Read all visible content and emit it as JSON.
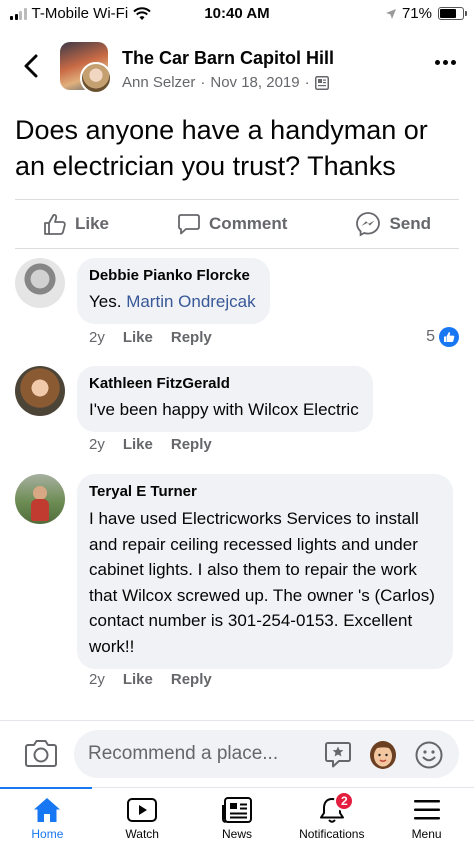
{
  "status_bar": {
    "carrier": "T-Mobile Wi-Fi",
    "time": "10:40 AM",
    "battery": "71%",
    "battery_level": 0.71
  },
  "header": {
    "group_name": "The Car Barn Capitol Hill",
    "author": "Ann Selzer",
    "separator": "·",
    "date": "Nov 18, 2019",
    "privacy_icon": "group-icon"
  },
  "post": {
    "text": "Does anyone have a handyman or an electrician you trust?  Thanks"
  },
  "post_actions": {
    "like": "Like",
    "comment": "Comment",
    "send": "Send"
  },
  "comments": [
    {
      "name": "Debbie Pianko Florcke",
      "text_prefix": "Yes. ",
      "mention": "Martin Ondrejcak",
      "age": "2y",
      "like": "Like",
      "reply": "Reply",
      "reaction_count": "5"
    },
    {
      "name": "Kathleen FitzGerald",
      "text": "I've been happy with Wilcox Electric",
      "age": "2y",
      "like": "Like",
      "reply": "Reply"
    },
    {
      "name": "Teryal E Turner",
      "text": "I have used Electricworks Services to install and repair ceiling recessed lights and under cabinet lights. I also them to repair the work that Wilcox screwed up. The owner 's (Carlos) contact number is 301-254-0153. Excellent work!!",
      "age": "2y",
      "like": "Like",
      "reply": "Reply"
    }
  ],
  "composer": {
    "placeholder": "Recommend a place..."
  },
  "tab_bar": {
    "tabs": [
      {
        "label": "Home",
        "icon": "home-icon",
        "active": true
      },
      {
        "label": "Watch",
        "icon": "watch-icon"
      },
      {
        "label": "News",
        "icon": "news-icon"
      },
      {
        "label": "Notifications",
        "icon": "bell-icon",
        "badge": "2"
      },
      {
        "label": "Menu",
        "icon": "menu-icon"
      }
    ]
  },
  "colors": {
    "accent": "#1877f2",
    "mention": "#385898",
    "secondary_text": "#65676b",
    "bubble": "#f0f2f5",
    "badge": "#e41e3f"
  }
}
